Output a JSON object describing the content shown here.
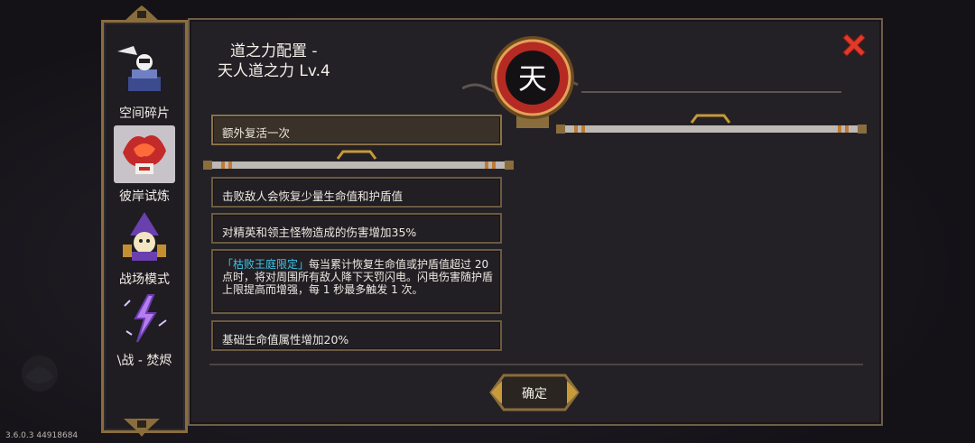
{
  "sidebar": {
    "items": [
      {
        "label": "空间碎片",
        "icon": "space-fragment-icon",
        "active": false
      },
      {
        "label": "彼岸试炼",
        "icon": "phoenix-trial-icon",
        "active": true
      },
      {
        "label": "战场模式",
        "icon": "battlefield-wizard-icon",
        "active": false
      },
      {
        "label": "\\战 - 焚烬",
        "icon": "lightning-fight-icon",
        "active": false
      }
    ]
  },
  "dialog": {
    "title_line1": "道之力配置 -",
    "title_line2": "天人道之力 Lv.4",
    "emblem_char": "天",
    "header_card": "额外复活一次",
    "cards": [
      {
        "text": "击败敌人会恢复少量生命值和护盾值"
      },
      {
        "text": "对精英和领主怪物造成的伤害增加35%"
      },
      {
        "tag": "「枯败王庭限定」",
        "text": "每当累计恢复生命值或护盾值超过 20 点时，将对周围所有敌人降下天罚闪电。闪电伤害随护盾上限提高而增强，每 1 秒最多触发 1 次。"
      },
      {
        "text": "基础生命值属性增加20%"
      }
    ],
    "confirm_label": "确定"
  },
  "version": "3.6.0.3 44918684",
  "colors": {
    "tag": "#3cc5e8",
    "close": "#e23a2a",
    "emblem_red": "#b52a22",
    "gold": "#8a6d3d"
  }
}
